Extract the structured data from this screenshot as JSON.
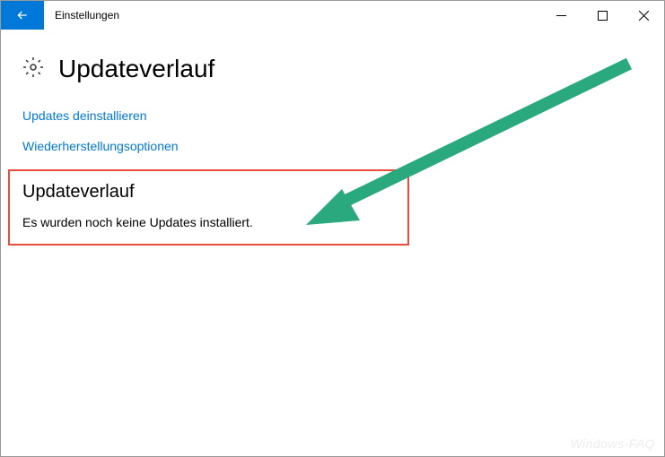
{
  "window": {
    "title": "Einstellungen"
  },
  "page": {
    "heading": "Updateverlauf"
  },
  "links": {
    "uninstall": "Updates deinstallieren",
    "recovery": "Wiederherstellungsoptionen"
  },
  "section": {
    "heading": "Updateverlauf",
    "body": "Es wurden noch keine Updates installiert."
  },
  "watermark": "Windows-FAQ"
}
